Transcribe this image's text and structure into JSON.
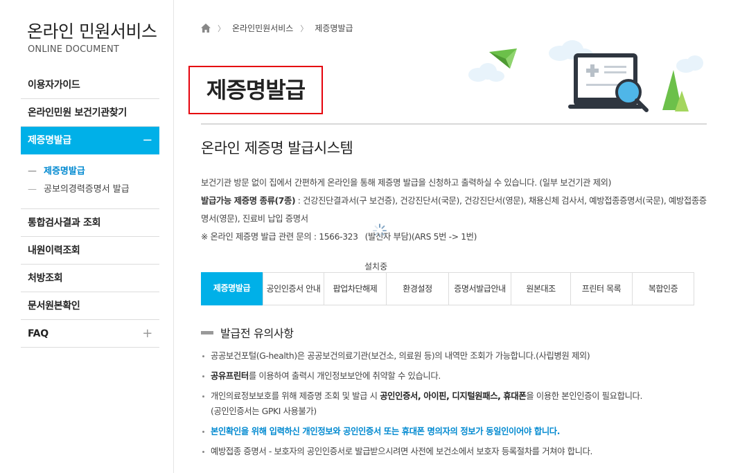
{
  "sidebar": {
    "title": "온라인 민원서비스",
    "subtitle": "ONLINE DOCUMENT",
    "menu": {
      "guide": "이용자가이드",
      "find": "온라인민원 보건기관찾기",
      "cert": "제증명발급",
      "cert_sign": "−",
      "sub_cert": "제증명발급",
      "sub_career": "공보의경력증명서 발급",
      "integrated": "통합검사결과 조회",
      "visits": "내원이력조회",
      "prescription": "처방조회",
      "original": "문서원본확인",
      "faq": "FAQ",
      "faq_sign": "+"
    }
  },
  "breadcrumb": {
    "home_icon": "home-icon",
    "sep": "〉",
    "items": [
      "온라인민원서비스",
      "제증명발급"
    ]
  },
  "page_title": "제증명발급",
  "section_title": "온라인 제증명 발급시스템",
  "intro": {
    "line1": "보건기관 방문 없이 집에서 간편하게 온라인을 통해 제증명 발급을 신청하고 출력하실 수 있습니다. (일부 보건기관 제외)",
    "kinds_label": "발급가능 제증명 종류(7종)",
    "kinds_text": " : 건강진단결과서(구 보건증), 건강진단서(국문), 건강진단서(영문), 채용신체 검사서, 예방접종증명서(국문), 예방접종증명서(영문), 진료비 납입 증명서",
    "contact": "※ 온라인 제증명 발급 관련 문의 : 1566-323",
    "contact_tail": "(발신자 부담)(ARS 5번 -> 1번)"
  },
  "installing_label": "설치중",
  "tabs": [
    "제증명발급",
    "공인인증서 안내",
    "팝업차단해제",
    "환경설정",
    "증명서발급안내",
    "원본대조",
    "프린터 목록",
    "복합인증"
  ],
  "notice": {
    "title": "발급전 유의사항",
    "items": {
      "i1": "공공보건포털(G-health)은 공공보건의료기관(보건소, 의료원 등)의 내역만 조회가 가능합니다.(사립병원 제외)",
      "i2_bold": "공유프린터",
      "i2_rest": "를 이용하여 출력시 개인정보보안에 취약할 수 있습니다.",
      "i3_pre": "개인의료정보보호를 위해 제증명 조회 및 발급 시 ",
      "i3_bold1": "공인인증서, 아이핀, 디지털원패스, 휴대폰",
      "i3_post": "을 이용한 본인인증이 필요합니다.",
      "i3_line2": "(공인인증서는 GPKI 사용불가)",
      "i4": "본인확인을 위해 입력하신 개인정보와 공인인증서 또는 휴대폰 명의자의 정보가 동일인이어야 합니다.",
      "i5": "예방접종 증명서 - 보호자의 공인인증서로 발급받으시려면 사전에 보건소에서 보호자 등록절차를 거쳐야 합니다."
    }
  },
  "colors": {
    "accent": "#00b0e8",
    "title_border": "#e5000b",
    "link_blue": "#0089d0",
    "paper_plane": "#6cc04a",
    "monitor": "#2f3640",
    "magnifier": "#4fb6e8"
  }
}
